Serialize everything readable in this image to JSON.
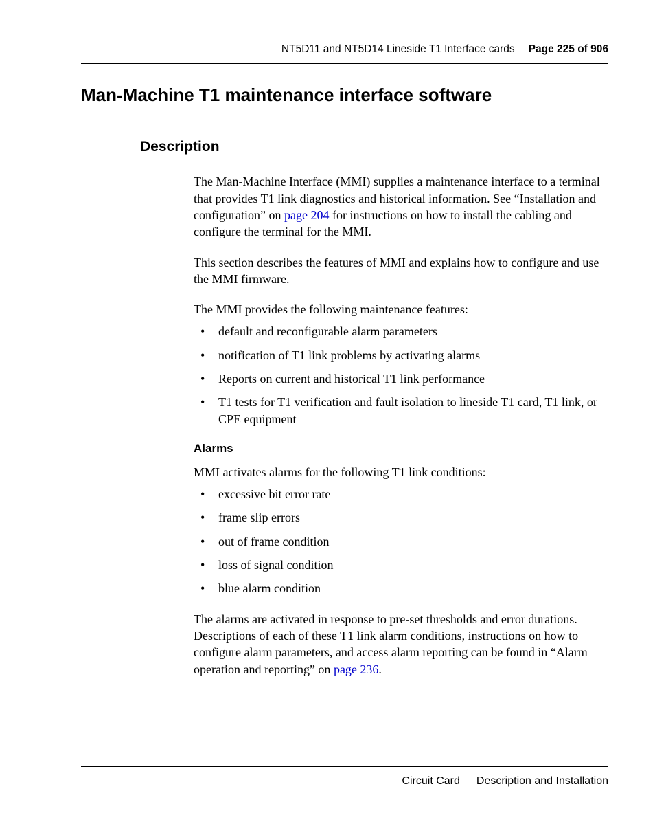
{
  "header": {
    "chapter": "NT5D11 and NT5D14 Lineside T1 Interface cards",
    "page_label": "Page 225 of 906"
  },
  "h1": "Man-Machine T1 maintenance interface software",
  "h2": "Description",
  "p1_a": "The Man-Machine Interface (MMI) supplies a maintenance interface to a terminal that provides T1 link diagnostics and historical information. See “Installation and configuration” on ",
  "p1_link": "page 204",
  "p1_b": " for instructions on how to install the cabling and configure the terminal for the MMI.",
  "p2": "This section describes the features of MMI and explains how to configure and use the MMI firmware.",
  "p3": "The MMI provides the following maintenance features:",
  "list1": [
    "default and reconfigurable alarm parameters",
    "notification of T1 link problems by activating alarms",
    "Reports on current and historical T1 link performance",
    "T1 tests for T1 verification and fault isolation to lineside T1 card, T1 link, or CPE equipment"
  ],
  "h3": "Alarms",
  "p4": "MMI activates alarms for the following T1 link conditions:",
  "list2": [
    "excessive bit error rate",
    "frame slip errors",
    "out of frame condition",
    "loss of signal condition",
    "blue alarm condition"
  ],
  "p5_a": "The alarms are activated in response to pre-set thresholds and error durations. Descriptions of each of these T1 link alarm conditions, instructions on how to configure alarm parameters, and access alarm reporting can be found in “Alarm operation and reporting” on ",
  "p5_link": "page 236",
  "p5_b": ".",
  "footer": {
    "left": "Circuit Card",
    "right": "Description and Installation"
  }
}
